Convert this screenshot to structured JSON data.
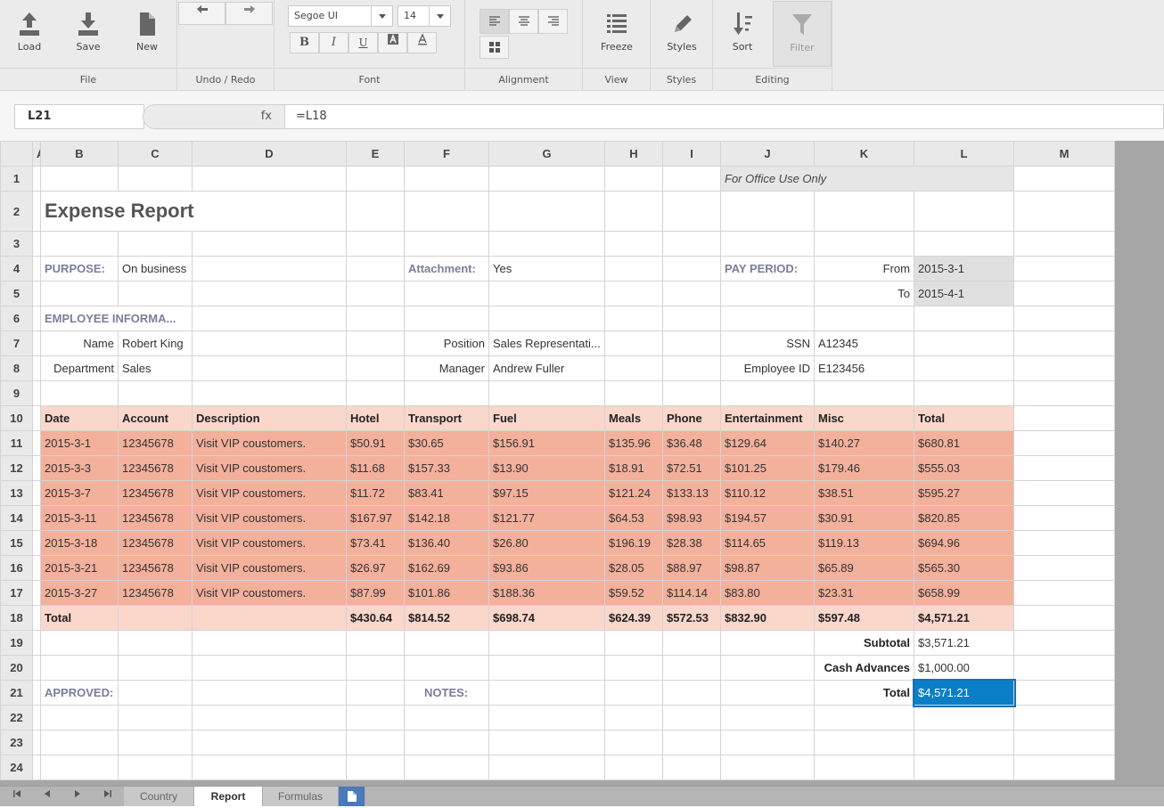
{
  "ribbon": {
    "file": {
      "label": "File",
      "load": "Load",
      "save": "Save",
      "new": "New"
    },
    "undo": {
      "label": "Undo / Redo"
    },
    "font": {
      "label": "Font",
      "family": "Segoe UI",
      "size": "14",
      "bold": "B",
      "italic": "I",
      "underline": "U"
    },
    "alignment": {
      "label": "Alignment"
    },
    "view": {
      "label": "View",
      "freeze": "Freeze"
    },
    "styles": {
      "label": "Styles",
      "styles": "Styles"
    },
    "editing": {
      "label": "Editing",
      "sort": "Sort",
      "filter": "Filter"
    }
  },
  "formula_bar": {
    "cell": "L21",
    "fx": "fx",
    "formula": "=L18"
  },
  "columns": [
    "A",
    "B",
    "C",
    "D",
    "E",
    "F",
    "G",
    "H",
    "I",
    "J",
    "K",
    "L",
    "M"
  ],
  "sheet": {
    "office_use": "For Office Use Only",
    "title": "Expense Report",
    "purpose_label": "PURPOSE:",
    "purpose": "On business",
    "attachment_label": "Attachment:",
    "attachment": "Yes",
    "pay_period_label": "PAY PERIOD:",
    "from_label": "From",
    "from": "2015-3-1",
    "to_label": "To",
    "to": "2015-4-1",
    "employee_info": "EMPLOYEE INFORMA...",
    "name_label": "Name",
    "name": "Robert King",
    "position_label": "Position",
    "position": "Sales Representati...",
    "ssn_label": "SSN",
    "ssn": "A12345",
    "department_label": "Department",
    "department": "Sales",
    "manager_label": "Manager",
    "manager": "Andrew Fuller",
    "employee_id_label": "Employee ID",
    "employee_id": "E123456",
    "table_headers": [
      "Date",
      "Account",
      "Description",
      "Hotel",
      "Transport",
      "Fuel",
      "Meals",
      "Phone",
      "Entertainment",
      "Misc",
      "Total"
    ],
    "rows": [
      [
        "2015-3-1",
        "12345678",
        "Visit VIP coustomers.",
        "$50.91",
        "$30.65",
        "$156.91",
        "$135.96",
        "$36.48",
        "$129.64",
        "$140.27",
        "$680.81"
      ],
      [
        "2015-3-3",
        "12345678",
        "Visit VIP coustomers.",
        "$11.68",
        "$157.33",
        "$13.90",
        "$18.91",
        "$72.51",
        "$101.25",
        "$179.46",
        "$555.03"
      ],
      [
        "2015-3-7",
        "12345678",
        "Visit VIP coustomers.",
        "$11.72",
        "$83.41",
        "$97.15",
        "$121.24",
        "$133.13",
        "$110.12",
        "$38.51",
        "$595.27"
      ],
      [
        "2015-3-11",
        "12345678",
        "Visit VIP coustomers.",
        "$167.97",
        "$142.18",
        "$121.77",
        "$64.53",
        "$98.93",
        "$194.57",
        "$30.91",
        "$820.85"
      ],
      [
        "2015-3-18",
        "12345678",
        "Visit VIP coustomers.",
        "$73.41",
        "$136.40",
        "$26.80",
        "$196.19",
        "$28.38",
        "$114.65",
        "$119.13",
        "$694.96"
      ],
      [
        "2015-3-21",
        "12345678",
        "Visit VIP coustomers.",
        "$26.97",
        "$162.69",
        "$93.86",
        "$28.05",
        "$88.97",
        "$98.87",
        "$65.89",
        "$565.30"
      ],
      [
        "2015-3-27",
        "12345678",
        "Visit VIP coustomers.",
        "$87.99",
        "$101.86",
        "$188.36",
        "$59.52",
        "$114.14",
        "$83.80",
        "$23.31",
        "$658.99"
      ]
    ],
    "total_label": "Total",
    "totals": [
      "$430.64",
      "$814.52",
      "$698.74",
      "$624.39",
      "$572.53",
      "$832.90",
      "$597.48",
      "$4,571.21"
    ],
    "subtotal_label": "Subtotal",
    "subtotal": "$3,571.21",
    "advances_label": "Cash Advances",
    "advances": "$1,000.00",
    "grand_total_label": "Total",
    "grand_total": "$4,571.21",
    "approved_label": "APPROVED:",
    "notes_label": "NOTES:"
  },
  "tabs": [
    "Country",
    "Report",
    "Formulas"
  ],
  "active_tab": "Report",
  "colors": {
    "header_fill": "#f9d7ca",
    "data_fill": "#f3b09b",
    "selection": "#0a7fc8",
    "label": "#7a7e99"
  }
}
